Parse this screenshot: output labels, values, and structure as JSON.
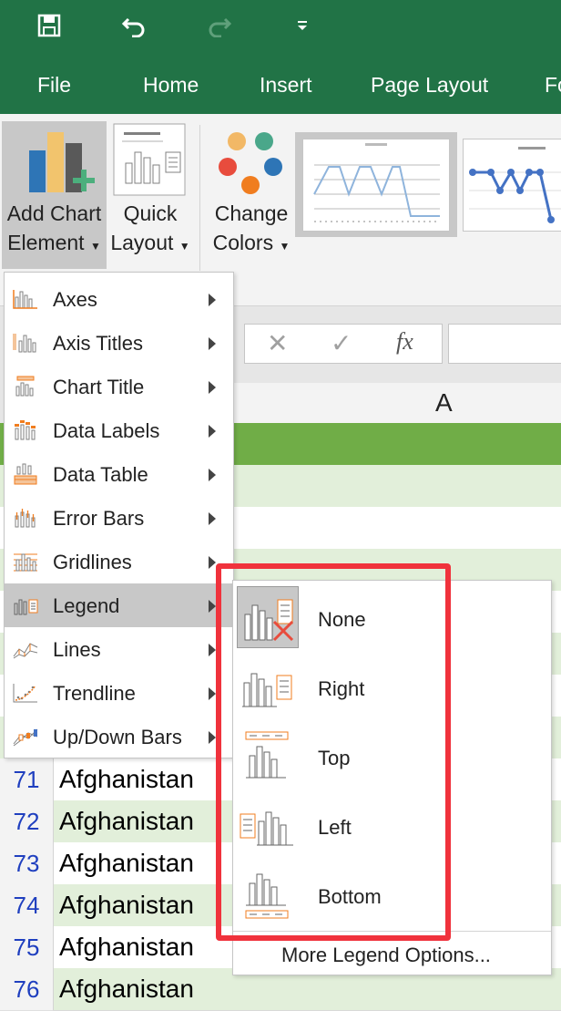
{
  "ribbon": {
    "tabs": [
      "File",
      "Home",
      "Insert",
      "Page Layout",
      "Fo"
    ],
    "add_chart_element": [
      "Add Chart",
      "Element"
    ],
    "quick_layout": [
      "Quick",
      "Layout"
    ],
    "change_colors": [
      "Change",
      "Colors"
    ]
  },
  "column_header": "A",
  "add_chart_menu": {
    "items": [
      {
        "label": "Axes",
        "icon": "axes-icon"
      },
      {
        "label": "Axis Titles",
        "icon": "axis-titles-icon"
      },
      {
        "label": "Chart Title",
        "icon": "chart-title-icon"
      },
      {
        "label": "Data Labels",
        "icon": "data-labels-icon"
      },
      {
        "label": "Data Table",
        "icon": "data-table-icon"
      },
      {
        "label": "Error Bars",
        "icon": "error-bars-icon"
      },
      {
        "label": "Gridlines",
        "icon": "gridlines-icon"
      },
      {
        "label": "Legend",
        "icon": "legend-icon",
        "highlighted": true
      },
      {
        "label": "Lines",
        "icon": "lines-icon"
      },
      {
        "label": "Trendline",
        "icon": "trendline-icon"
      },
      {
        "label": "Up/Down Bars",
        "icon": "up-down-bars-icon"
      }
    ]
  },
  "legend_submenu": {
    "items": [
      {
        "label": "None",
        "icon": "legend-none-icon",
        "selected": true
      },
      {
        "label": "Right",
        "icon": "legend-right-icon"
      },
      {
        "label": "Top",
        "icon": "legend-top-icon"
      },
      {
        "label": "Left",
        "icon": "legend-left-icon"
      },
      {
        "label": "Bottom",
        "icon": "legend-bottom-icon"
      }
    ],
    "more_options": "More Legend Options..."
  },
  "rows": [
    {
      "num": "71",
      "value": "Afghanistan"
    },
    {
      "num": "72",
      "value": "Afghanistan"
    },
    {
      "num": "73",
      "value": "Afghanistan"
    },
    {
      "num": "74",
      "value": "Afghanistan"
    },
    {
      "num": "75",
      "value": "Afghanistan"
    },
    {
      "num": "76",
      "value": "Afghanistan"
    }
  ],
  "colors": {
    "excel_green": "#217346",
    "highlight": "#f0323c",
    "header_green": "#70ad47"
  }
}
